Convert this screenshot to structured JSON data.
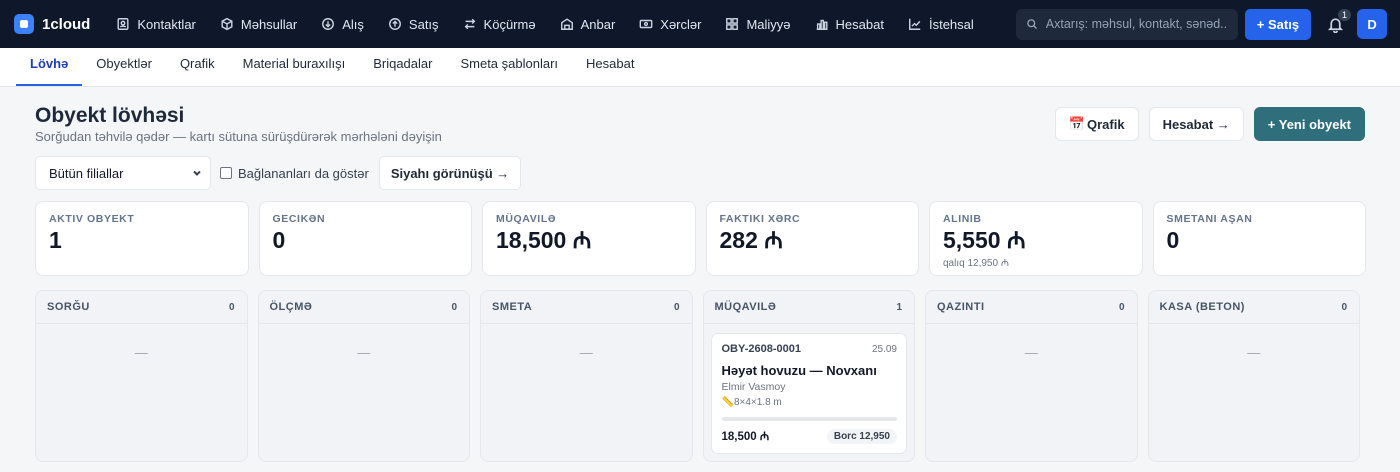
{
  "app": {
    "name": "1cloud"
  },
  "nav": {
    "items": [
      {
        "label": "Kontaktlar",
        "icon": "contact-icon"
      },
      {
        "label": "Məhsullar",
        "icon": "box-icon"
      },
      {
        "label": "Alış",
        "icon": "download-icon"
      },
      {
        "label": "Satış",
        "icon": "upload-icon"
      },
      {
        "label": "Köçürmə",
        "icon": "transfer-icon"
      },
      {
        "label": "Anbar",
        "icon": "warehouse-icon"
      },
      {
        "label": "Xərclər",
        "icon": "cash-icon"
      },
      {
        "label": "Maliyyə",
        "icon": "grid-icon"
      },
      {
        "label": "Hesabat",
        "icon": "bar-chart-icon"
      },
      {
        "label": "İstehsal",
        "icon": "line-chart-icon"
      }
    ],
    "search_placeholder": "Axtarış: məhsul, kontakt, sənəd...",
    "sale_button": "+ Satış",
    "notification_count": "1",
    "avatar_initial": "D"
  },
  "tabs": [
    {
      "label": "Lövhə",
      "active": true
    },
    {
      "label": "Obyektlər",
      "active": false
    },
    {
      "label": "Qrafik",
      "active": false
    },
    {
      "label": "Material buraxılışı",
      "active": false
    },
    {
      "label": "Briqadalar",
      "active": false
    },
    {
      "label": "Smeta şablonları",
      "active": false
    },
    {
      "label": "Hesabat",
      "active": false
    }
  ],
  "page": {
    "title": "Obyekt lövhəsi",
    "subtitle": "Sorğudan təhvilə qədər — kartı sütuna sürüşdürərək mərhələni dəyişin",
    "actions": {
      "schedule_icon": "📅",
      "schedule": "Qrafik",
      "report": "Hesabat →",
      "new_object": "+ Yeni obyekt"
    }
  },
  "filters": {
    "branch_value": "Bütün filiallar",
    "show_connected_label": "Bağlananları da göstər",
    "show_connected_checked": false,
    "list_view": "Siyahı görünüşü →"
  },
  "stats": [
    {
      "label": "Aktiv obyekt",
      "value": "1",
      "extra": ""
    },
    {
      "label": "Gecikən",
      "value": "0",
      "extra": ""
    },
    {
      "label": "Müqavilə",
      "value": "18,500 ₼",
      "extra": ""
    },
    {
      "label": "Faktiki xərc",
      "value": "282 ₼",
      "extra": ""
    },
    {
      "label": "Alınıb",
      "value": "5,550 ₼",
      "extra": "qalıq 12,950 ₼"
    },
    {
      "label": "Smetanı aşan",
      "value": "0",
      "extra": ""
    }
  ],
  "columns": [
    {
      "title": "Sorğu",
      "count": "0",
      "empty": "—",
      "cards": []
    },
    {
      "title": "Ölçmə",
      "count": "0",
      "empty": "—",
      "cards": []
    },
    {
      "title": "Smeta",
      "count": "0",
      "empty": "—",
      "cards": []
    },
    {
      "title": "Müqavilə",
      "count": "1",
      "empty": "",
      "cards": [
        {
          "code": "OBY-2608-0001",
          "date": "25.09",
          "title": "Həyət hovuzu — Novxanı",
          "client": "Elmir Vasmoy",
          "dims": "📏8×4×1.8 m",
          "progress": 0,
          "amount": "18,500 ₼",
          "debt": "Borc 12,950"
        }
      ]
    },
    {
      "title": "Qazıntı",
      "count": "0",
      "empty": "—",
      "cards": []
    },
    {
      "title": "Kasa (beton)",
      "count": "0",
      "empty": "—",
      "cards": []
    }
  ]
}
